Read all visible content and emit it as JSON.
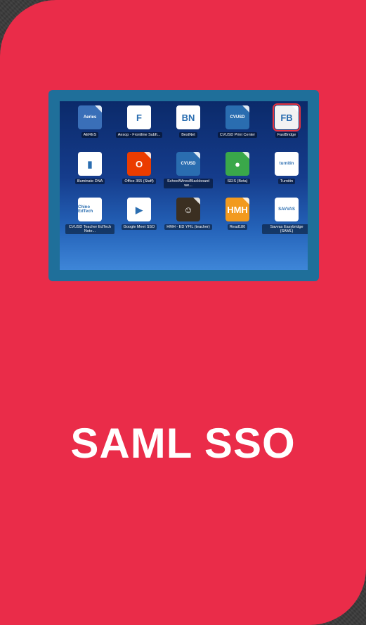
{
  "heading": "SAML SSO",
  "colors": {
    "card": "#ea2c49",
    "frame": "#1f6f9a",
    "selection": "#e8343f"
  },
  "apps": [
    {
      "label": "AERES",
      "icon": "aeries-icon",
      "bg": "#3a6fb8",
      "glyph": "Aeries",
      "selected": false
    },
    {
      "label": "Aesop - Frontline Subfi...",
      "icon": "frontline-icon",
      "bg": "#ffffff",
      "glyph": "F",
      "selected": false
    },
    {
      "label": "BestNet",
      "icon": "bestnet-icon",
      "bg": "#ffffff",
      "glyph": "BN",
      "selected": false
    },
    {
      "label": "CVUSD Print Center",
      "icon": "cvusd-print-icon",
      "bg": "#2a6db0",
      "glyph": "CVUSD",
      "selected": false
    },
    {
      "label": "FastBridge",
      "icon": "fastbridge-icon",
      "bg": "#f2f2f2",
      "glyph": "FB",
      "selected": true
    },
    {
      "label": "Illuminate DNA",
      "icon": "illuminate-icon",
      "bg": "#ffffff",
      "glyph": "▮",
      "selected": false
    },
    {
      "label": "Office 365 (Staff)",
      "icon": "office365-icon",
      "bg": "#eb3c00",
      "glyph": "O",
      "selected": false
    },
    {
      "label": "SchoolWires/Blackboard we...",
      "icon": "schoolwires-icon",
      "bg": "#2a6db0",
      "glyph": "CVUSD",
      "selected": false
    },
    {
      "label": "SEIS (Beta)",
      "icon": "seis-icon",
      "bg": "#3aa84a",
      "glyph": "●",
      "selected": false
    },
    {
      "label": "Turnitin",
      "icon": "turnitin-icon",
      "bg": "#ffffff",
      "glyph": "turnitin",
      "selected": false
    },
    {
      "label": "CVUSD Teacher EdTech Note...",
      "icon": "chino-edtech-icon",
      "bg": "#ffffff",
      "glyph": "Chino EdTech",
      "selected": false
    },
    {
      "label": "Google Meet SSO",
      "icon": "google-meet-icon",
      "bg": "#ffffff",
      "glyph": "▶",
      "selected": false
    },
    {
      "label": "HMH - ED YFIL (teacher)",
      "icon": "hmh-ed-icon",
      "bg": "#3b2f21",
      "glyph": "☺",
      "selected": false
    },
    {
      "label": "Read180",
      "icon": "hmh-central-icon",
      "bg": "#f29a1f",
      "glyph": "HMH",
      "selected": false
    },
    {
      "label": "Savvas Easybridge (SAML)",
      "icon": "savvas-icon",
      "bg": "#ffffff",
      "glyph": "SAVVAS",
      "selected": false
    }
  ]
}
